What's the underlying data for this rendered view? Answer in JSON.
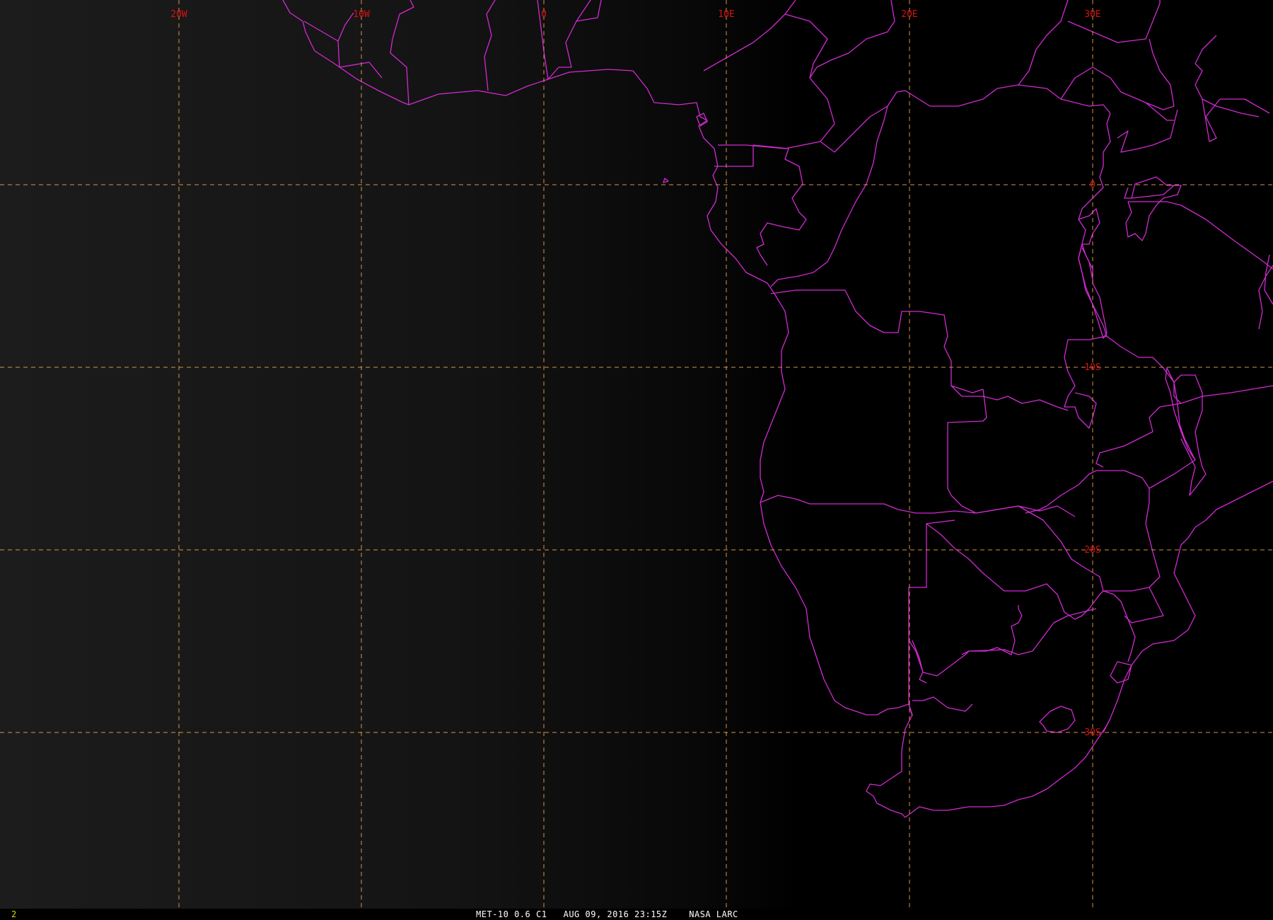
{
  "map": {
    "colors": {
      "background": "#000000",
      "night_gradient_from": "#1c1c1c",
      "borders": "#d22ad2",
      "grid": "#d89248",
      "grid_labels": "#d81212"
    },
    "longitude_labels": [
      "20W",
      "10W",
      "0",
      "10E",
      "20E",
      "30E"
    ],
    "latitude_labels": [
      "0",
      "10S",
      "20S",
      "30S"
    ]
  },
  "status_bar": {
    "frame_number": "2",
    "frame_number_color": "#d8d800",
    "image_info": "MET-10 0.6 C1   AUG 09, 2016 23:15Z    NASA LARC",
    "image_info_color": "#ffffff"
  }
}
